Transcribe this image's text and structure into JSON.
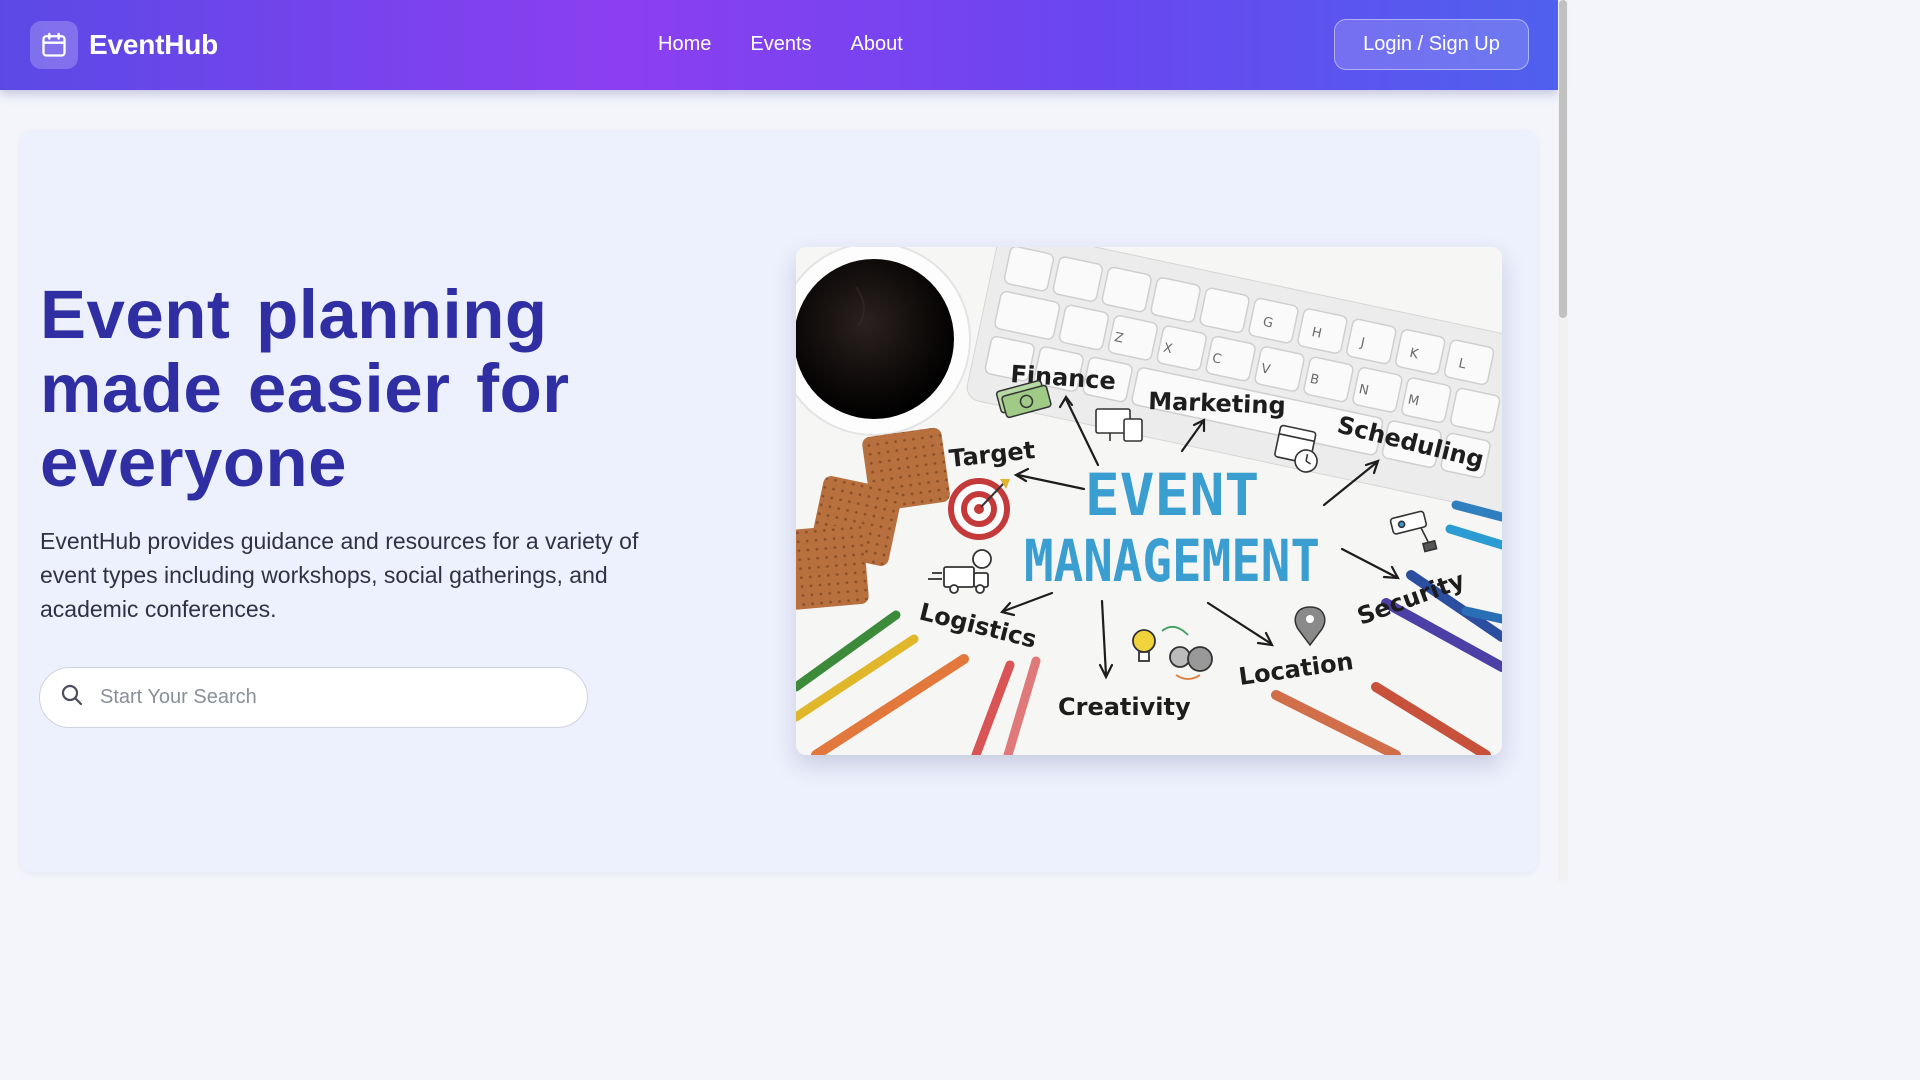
{
  "brand": {
    "name": "EventHub",
    "icon": "calendar-icon"
  },
  "nav": {
    "links": [
      "Home",
      "Events",
      "About"
    ]
  },
  "auth": {
    "login_label": "Login / Sign Up"
  },
  "hero": {
    "headline": "Event planning made easier for everyone",
    "description": "EventHub provides guidance and resources for a variety of event types including workshops, social gatherings, and academic conferences.",
    "search_placeholder": "Start Your Search",
    "search_icon": "search-icon"
  },
  "hero_image": {
    "title_line1": "EVENT",
    "title_line2": "MANAGEMENT",
    "labels": {
      "finance": "Finance",
      "marketing": "Marketing",
      "scheduling": "Scheduling",
      "target": "Target",
      "security": "Security",
      "logistics": "Logistics",
      "location": "Location",
      "creativity": "Creativity"
    },
    "keys": [
      "Z",
      "X",
      "C",
      "V",
      "B",
      "N",
      "M",
      "G",
      "H",
      "J",
      "K",
      "L"
    ]
  },
  "colors": {
    "nav_gradient_start": "#5b49e6",
    "nav_gradient_mid": "#8b3ff0",
    "nav_gradient_end": "#4f60ee",
    "headline": "#2f2fa3",
    "hero_bg": "#edf1fd",
    "event_management_text": "#3a9fd0"
  }
}
